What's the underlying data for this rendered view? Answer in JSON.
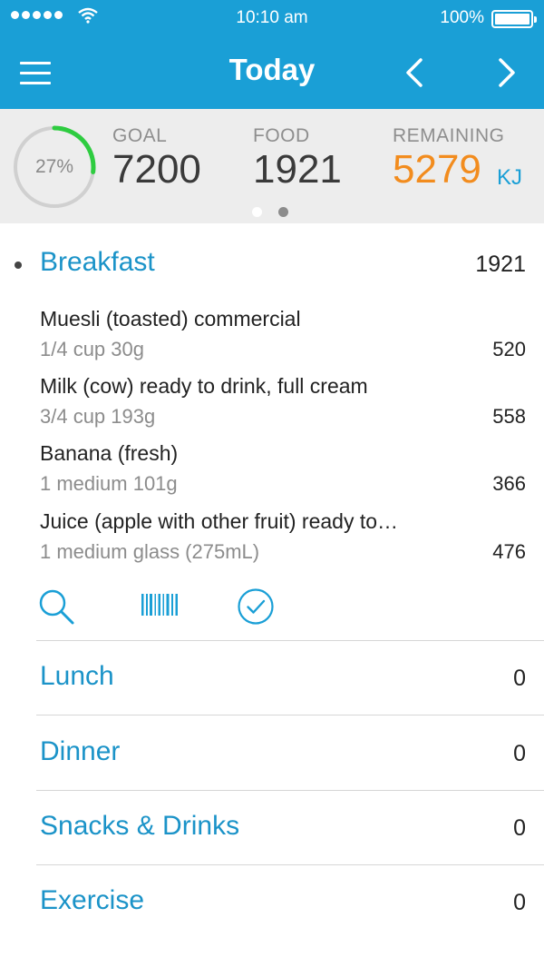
{
  "status_bar": {
    "time": "10:10 am",
    "battery": "100%"
  },
  "nav": {
    "title": "Today",
    "menu_icon": "hamburger-menu-icon",
    "prev_icon": "chevron-left-icon",
    "next_icon": "chevron-right-icon"
  },
  "summary": {
    "percent": 27,
    "percent_label": "27%",
    "goal_label": "GOAL",
    "goal_value": "7200",
    "food_label": "FOOD",
    "food_value": "1921",
    "remaining_label": "REMAINING",
    "remaining_value": "5279",
    "unit": "KJ",
    "pages": 2,
    "active_page": 0
  },
  "breakfast": {
    "name": "Breakfast",
    "total": "1921",
    "items": [
      {
        "name": "Muesli (toasted) commercial",
        "qty": "1/4 cup 30g",
        "kj": "520"
      },
      {
        "name": "Milk (cow) ready to drink, full cream",
        "qty": "3/4 cup 193g",
        "kj": "558"
      },
      {
        "name": "Banana (fresh)",
        "qty": "1 medium 101g",
        "kj": "366"
      },
      {
        "name": "Juice (apple with other fruit) ready to…",
        "qty": "1 medium glass (275mL)",
        "kj": "476"
      }
    ],
    "actions": [
      "search-icon",
      "barcode-icon",
      "checkmark-circle-icon"
    ]
  },
  "meals": [
    {
      "name": "Lunch",
      "total": "0"
    },
    {
      "name": "Dinner",
      "total": "0"
    },
    {
      "name": "Snacks & Drinks",
      "total": "0"
    },
    {
      "name": "Exercise",
      "total": "0"
    }
  ],
  "colors": {
    "brand_blue": "#1a9fd6",
    "link_blue": "#1b93c8",
    "progress_green": "#2ecc40",
    "remaining_orange": "#f28c1e",
    "summary_bg": "#ededed"
  }
}
